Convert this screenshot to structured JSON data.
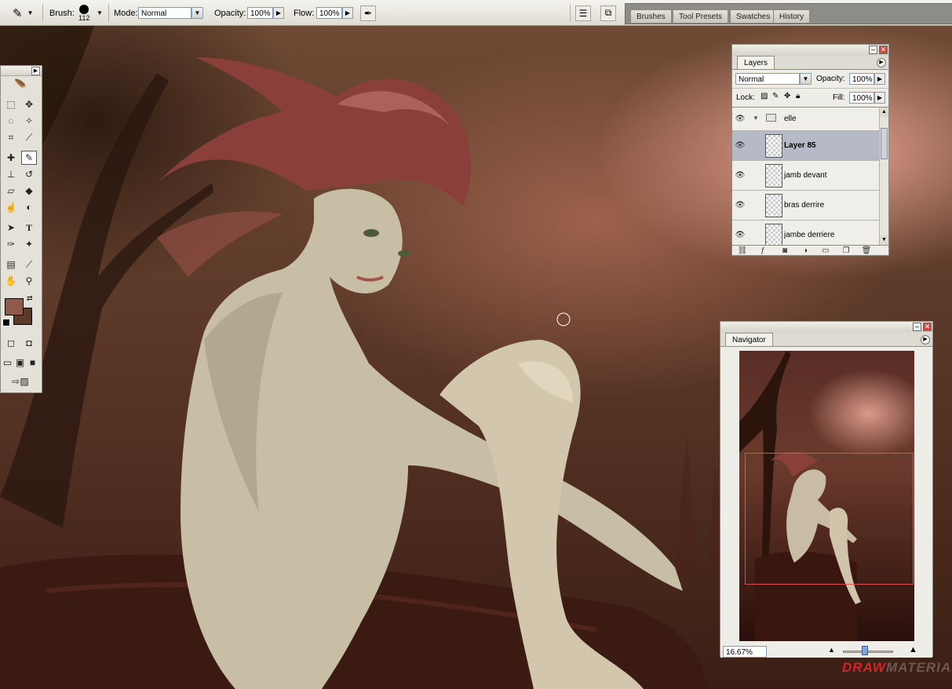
{
  "options_bar": {
    "brush_label": "Brush:",
    "brush_size": "112",
    "mode_label": "Mode:",
    "mode_value": "Normal",
    "opacity_label": "Opacity:",
    "opacity_value": "100%",
    "flow_label": "Flow:",
    "flow_value": "100%",
    "well_tabs": [
      "Brushes",
      "Tool Presets",
      "Swatches",
      "History"
    ]
  },
  "tool_palette": {
    "foreground_color": "#8e5a4a",
    "background_color": "#5b3a26"
  },
  "layers_panel": {
    "tab_label": "Layers",
    "blend_mode": "Normal",
    "opacity_label": "Opacity:",
    "opacity_value": "100%",
    "lock_label": "Lock:",
    "fill_label": "Fill:",
    "fill_value": "100%",
    "layers": [
      {
        "name": "elle",
        "type": "group"
      },
      {
        "name": "Layer 85",
        "selected": true
      },
      {
        "name": "jamb devant"
      },
      {
        "name": "bras derrire"
      },
      {
        "name": "jambe derriere"
      }
    ]
  },
  "navigator_panel": {
    "tab_label": "Navigator",
    "zoom_value": "16.67%",
    "view_box_color": "#e0524c"
  },
  "watermark": {
    "text_a": "DRAW",
    "text_b": "MATERIAL",
    "color_a": "#d8232a"
  }
}
